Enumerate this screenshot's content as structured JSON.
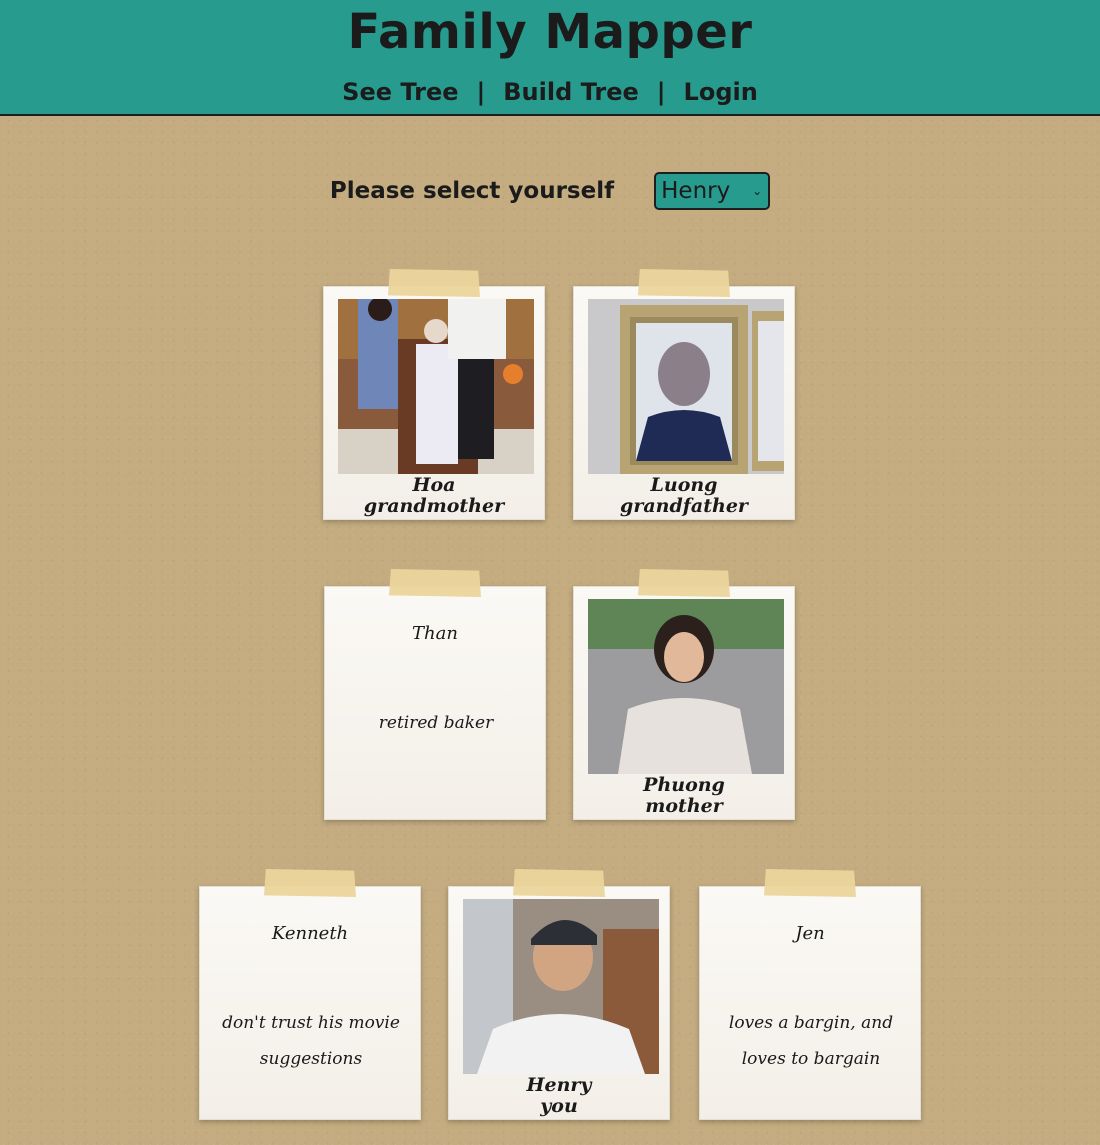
{
  "site": {
    "title": "Family Mapper"
  },
  "nav": [
    {
      "label": "See Tree"
    },
    {
      "label": "Build Tree"
    },
    {
      "label": "Login"
    }
  ],
  "nav_separator": "|",
  "selector": {
    "label": "Please select yourself",
    "selected": "Henry"
  },
  "cards": {
    "hoa": {
      "name": "Hoa",
      "relation": "grandmother",
      "type": "photo"
    },
    "luong": {
      "name": "Luong",
      "relation": "grandfather",
      "type": "photo"
    },
    "than": {
      "name": "Than",
      "note": "retired baker",
      "type": "text"
    },
    "phuong": {
      "name": "Phuong",
      "relation": "mother",
      "type": "photo"
    },
    "kenneth": {
      "name": "Kenneth",
      "note": "don't trust his movie suggestions",
      "type": "text"
    },
    "henry": {
      "name": "Henry",
      "relation": "you",
      "type": "photo"
    },
    "jen": {
      "name": "Jen",
      "note": "loves a bargin, and loves to bargain",
      "type": "text"
    }
  },
  "colors": {
    "header": "#289b8f",
    "background": "#c4ac80",
    "tape": "#ebd59c",
    "card": "#fbf9f5"
  }
}
